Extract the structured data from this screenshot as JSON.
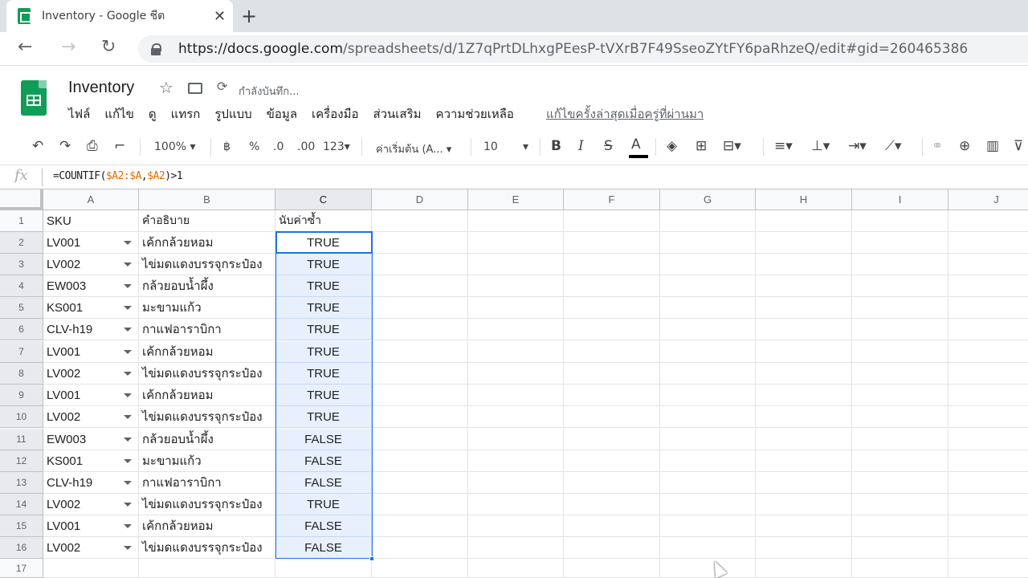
{
  "browser": {
    "tab_title": "Inventory - Google ชีต",
    "url_host": "https://docs.google.com",
    "url_path": "/spreadsheets/d/1Z7qPrtDLhxgPEesP-tVXrB7F49SseoZYtFY6paRhzeQ/edit#gid=260465386"
  },
  "doc": {
    "title": "Inventory",
    "save_status": "กำลังบันทึก...",
    "menu": [
      "ไฟล์",
      "แก้ไข",
      "ดู",
      "แทรก",
      "รูปแบบ",
      "ข้อมูล",
      "เครื่องมือ",
      "ส่วนเสริม",
      "ความช่วยเหลือ"
    ],
    "last_edit": "แก้ไขครั้งล่าสุดเมื่อครู่ที่ผ่านมา"
  },
  "toolbar": {
    "zoom": "100%",
    "currency": "฿",
    "percent": "%",
    "decrease_decimal": ".0",
    "increase_decimal": ".00",
    "more_formats": "123",
    "font": "ค่าเริ่มต้น (A...",
    "font_size": "10",
    "bold": "B",
    "italic": "I",
    "strike": "S",
    "text_color": "A"
  },
  "formula_bar": {
    "fx": "fx",
    "formula_prefix": "=COUNTIF(",
    "ref1": "$A2:$A",
    "comma": ",",
    "ref2": "$A2",
    "formula_suffix": ")>1"
  },
  "sheet": {
    "columns": [
      "A",
      "B",
      "C",
      "D",
      "E",
      "F",
      "G",
      "H",
      "I",
      "J"
    ],
    "row_numbers": [
      "1",
      "2",
      "3",
      "4",
      "5",
      "6",
      "7",
      "8",
      "9",
      "10",
      "11",
      "12",
      "13",
      "14",
      "15",
      "16",
      "17"
    ],
    "header": {
      "a": "SKU",
      "b": "คำอธิบาย",
      "c": "นับค่าซ้ำ"
    },
    "rows": [
      {
        "sku": "LV001",
        "desc": "เค้กกล้วยหอม",
        "dup": "TRUE"
      },
      {
        "sku": "LV002",
        "desc": "ไข่มดแดงบรรจุกระป๋อง",
        "dup": "TRUE"
      },
      {
        "sku": "EW003",
        "desc": "กล้วยอบน้ำผึ้ง",
        "dup": "TRUE"
      },
      {
        "sku": "KS001",
        "desc": "มะขามแก้ว",
        "dup": "TRUE"
      },
      {
        "sku": "CLV-h19",
        "desc": "กาแฟอาราบิกา",
        "dup": "TRUE"
      },
      {
        "sku": "LV001",
        "desc": "เค้กกล้วยหอม",
        "dup": "TRUE"
      },
      {
        "sku": "LV002",
        "desc": "ไข่มดแดงบรรจุกระป๋อง",
        "dup": "TRUE"
      },
      {
        "sku": "LV001",
        "desc": "เค้กกล้วยหอม",
        "dup": "TRUE"
      },
      {
        "sku": "LV002",
        "desc": "ไข่มดแดงบรรจุกระป๋อง",
        "dup": "TRUE"
      },
      {
        "sku": "EW003",
        "desc": "กล้วยอบน้ำผึ้ง",
        "dup": "FALSE"
      },
      {
        "sku": "KS001",
        "desc": "มะขามแก้ว",
        "dup": "FALSE"
      },
      {
        "sku": "CLV-h19",
        "desc": "กาแฟอาราบิกา",
        "dup": "FALSE"
      },
      {
        "sku": "LV002",
        "desc": "ไข่มดแดงบรรจุกระป๋อง",
        "dup": "TRUE"
      },
      {
        "sku": "LV001",
        "desc": "เค้กกล้วยหอม",
        "dup": "FALSE"
      },
      {
        "sku": "LV002",
        "desc": "ไข่มดแดงบรรจุกระป๋อง",
        "dup": "FALSE"
      }
    ]
  },
  "colors": {
    "selection": "#1a73e8",
    "selection_fill": "#e8f0fe",
    "sheets_green": "#0f9d58"
  }
}
